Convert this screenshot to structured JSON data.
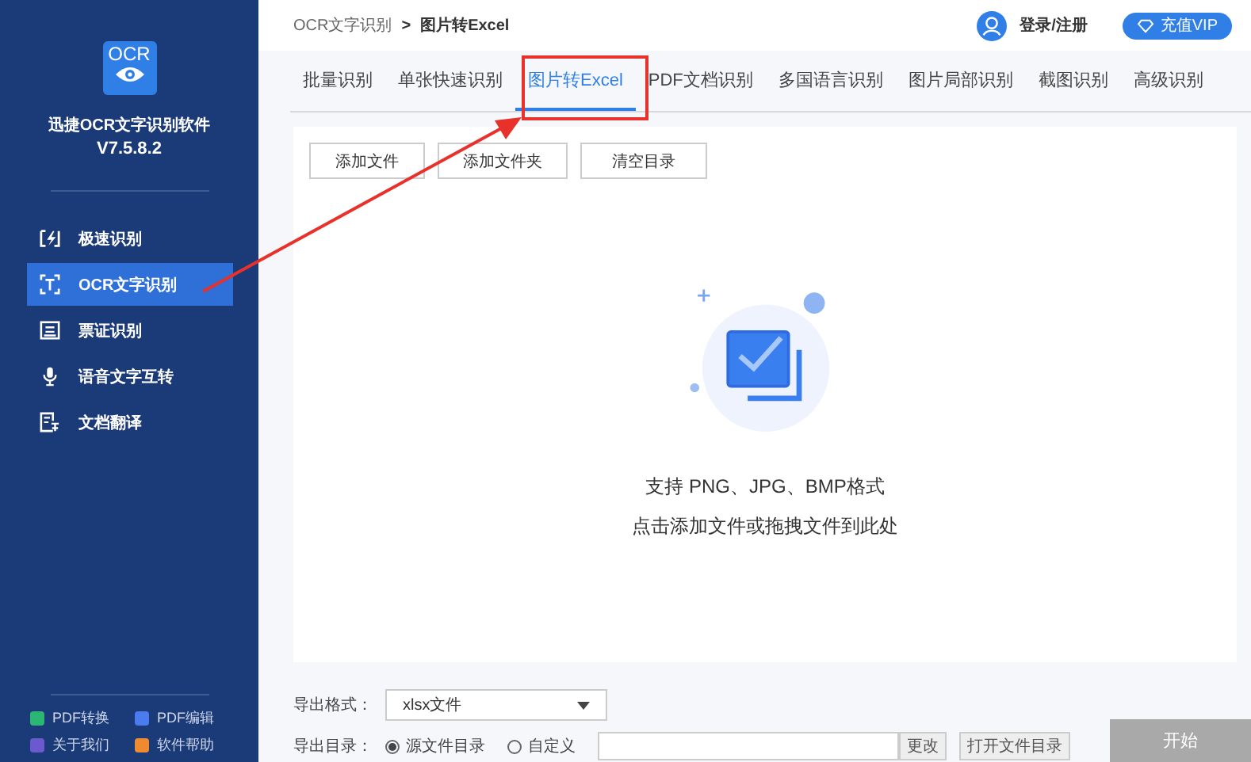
{
  "sidebar": {
    "logo_text": "OCR",
    "app_name": "迅捷OCR文字识别软件",
    "version": "V7.5.8.2",
    "items": [
      {
        "label": "极速识别",
        "selected": false
      },
      {
        "label": "OCR文字识别",
        "selected": true
      },
      {
        "label": "票证识别",
        "selected": false
      },
      {
        "label": "语音文字互转",
        "selected": false
      },
      {
        "label": "文档翻译",
        "selected": false
      }
    ],
    "bottom_links": [
      {
        "label": "PDF转换",
        "color": "#2bb673"
      },
      {
        "label": "PDF编辑",
        "color": "#4a7cf0"
      },
      {
        "label": "关于我们",
        "color": "#6a5acd"
      },
      {
        "label": "软件帮助",
        "color": "#f08a30"
      }
    ]
  },
  "header": {
    "breadcrumb": [
      "OCR文字识别",
      "图片转Excel"
    ],
    "breadcrumb_separator": ">",
    "login": "登录/注册",
    "vip": "充值VIP"
  },
  "tabs": [
    {
      "label": "批量识别",
      "selected": false
    },
    {
      "label": "单张快速识别",
      "selected": false
    },
    {
      "label": "图片转Excel",
      "selected": true
    },
    {
      "label": "PDF文档识别",
      "selected": false
    },
    {
      "label": "多国语言识别",
      "selected": false
    },
    {
      "label": "图片局部识别",
      "selected": false
    },
    {
      "label": "截图识别",
      "selected": false
    },
    {
      "label": "高级识别",
      "selected": false
    }
  ],
  "toolbar": [
    "添加文件",
    "添加文件夹",
    "清空目录"
  ],
  "dropzone": {
    "line_1": "支持 PNG、JPG、BMP格式",
    "line_2": "点击添加文件或拖拽文件到此处"
  },
  "export": {
    "format_label": "导出格式：",
    "format_value": "xlsx文件",
    "dir_label": "导出目录：",
    "options": [
      {
        "label": "源文件目录",
        "selected": true
      },
      {
        "label": "自定义",
        "selected": false
      }
    ],
    "change": "更改",
    "open": "打开文件目录"
  },
  "start": "开始"
}
